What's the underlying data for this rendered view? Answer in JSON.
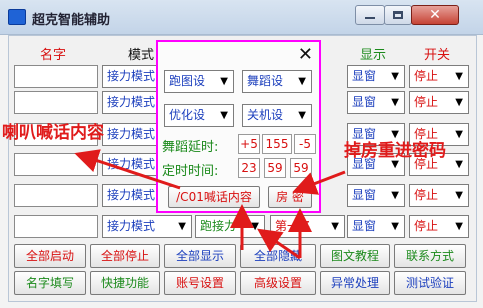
{
  "title": "超克智能辅助",
  "headers": {
    "name": "名字",
    "mode": "模式",
    "display": "显示",
    "switch": "开关"
  },
  "rows": [
    {
      "mode": "接力模式",
      "action": "",
      "display": "显窗",
      "switch": "停止"
    },
    {
      "mode": "接力模式",
      "action": "",
      "display": "显窗",
      "switch": "停止"
    },
    {
      "mode": "接力模式",
      "action": "",
      "display": "显窗",
      "switch": "停止"
    },
    {
      "mode": "接力模式",
      "action": "",
      "display": "显窗",
      "switch": "停止"
    },
    {
      "mode": "接力模式",
      "action": "",
      "display": "显窗",
      "switch": "停止"
    },
    {
      "mode": "接力模式",
      "action": "跑接力",
      "position": "第一名",
      "display": "显窗",
      "switch": "停止"
    }
  ],
  "popup": {
    "run_setting": "跑图设",
    "dance_setting": "舞蹈设",
    "optimize_setting": "优化设",
    "shutdown_setting": "关机设",
    "dance_delay_label": "舞蹈延时:",
    "dance_delay_plus": "+5",
    "dance_delay_value": "155",
    "dance_delay_minus": "-5",
    "timer_label": "定时时间:",
    "timer_h": "23",
    "timer_m": "59",
    "timer_s": "59",
    "shout_button": "/C01喊话内容",
    "room_password_button": "房 密"
  },
  "buttons_row1": [
    "全部启动",
    "全部停止",
    "全部显示",
    "全部隐藏",
    "图文教程",
    "联系方式"
  ],
  "buttons_row2": [
    "名字填写",
    "快捷功能",
    "账号设置",
    "高级设置",
    "异常处理",
    "测试验证"
  ],
  "annotations": {
    "shout": "喇叭喊话内容",
    "password": "掉房重进密码"
  },
  "colors": {
    "red": "#d81111",
    "blue": "#1c3fbd",
    "green": "#1c8a1c",
    "popup_border": "#ff00ff"
  }
}
